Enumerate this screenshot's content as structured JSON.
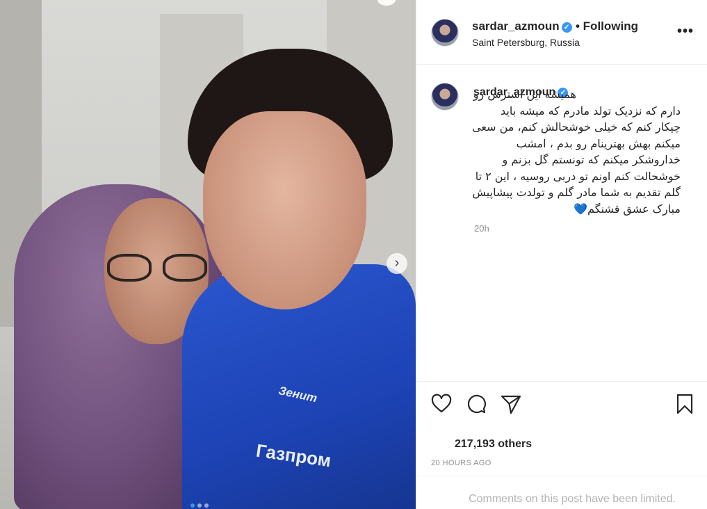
{
  "post": {
    "username": "sardar_azmoun",
    "follow_label": "• Following",
    "location": "Saint Petersburg, Russia",
    "more_label": "•••",
    "media": {
      "next_arrow": "›",
      "shirt_logo_text": "Зенит",
      "shirt_sponsor_text": "Газпром",
      "carousel_count": 3,
      "carousel_active": 1
    },
    "caption": {
      "text": "همیشه این استرس رو دارم که نزدیک تولد مادرم که میشه باید چیکار کنم که خیلی خوشحالش کنم، من سعی میکنم بهش بهترینام رو بدم ، امشب خداروشکر میکنم که تونستم گل بزنم و خوشحالت کنم اونم تو دربی روسیه ، این ۲ تا گلم تقدیم به شما مادر گلم و تولدت پیشاپیش مبارک عشق قشنگم💙",
      "time": "20h"
    },
    "likes_text": "217,193 others",
    "posted_ago": "20 HOURS AGO",
    "comments_notice": "Comments on this post have been limited."
  }
}
